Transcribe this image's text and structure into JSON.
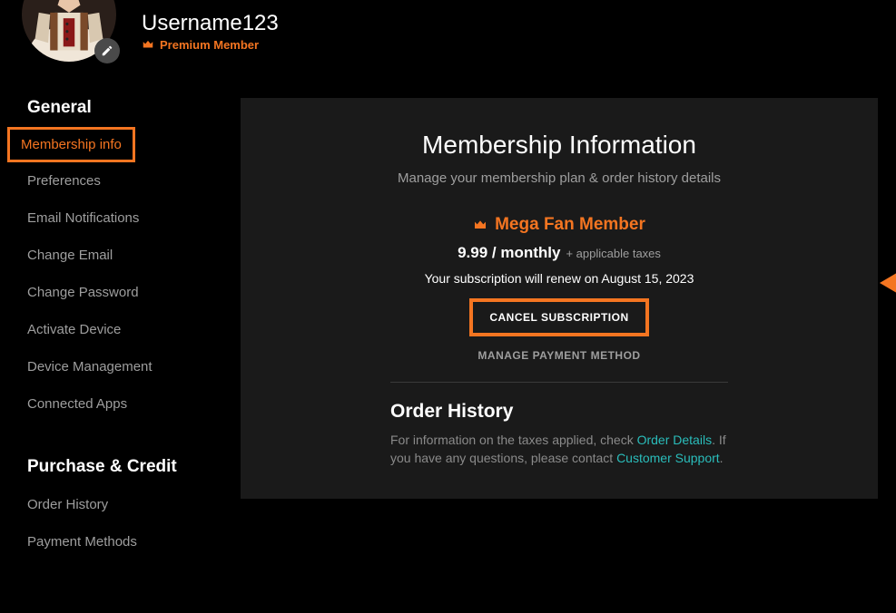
{
  "user": {
    "name": "Username123",
    "badge": "Premium Member"
  },
  "sidebar": {
    "groups": [
      {
        "heading": "General",
        "items": [
          {
            "label": "Membership info",
            "active": true
          },
          {
            "label": "Preferences"
          },
          {
            "label": "Email Notifications"
          },
          {
            "label": "Change Email"
          },
          {
            "label": "Change Password"
          },
          {
            "label": "Activate Device"
          },
          {
            "label": "Device Management"
          },
          {
            "label": "Connected Apps"
          }
        ]
      },
      {
        "heading": "Purchase & Credit",
        "items": [
          {
            "label": "Order History"
          },
          {
            "label": "Payment Methods"
          }
        ]
      }
    ]
  },
  "main": {
    "title": "Membership Information",
    "subtitle": "Manage your membership plan & order history details",
    "plan_name": "Mega Fan Member",
    "price": "9.99 / monthly",
    "tax_note": "+ applicable taxes",
    "renew_note": "Your subscription will renew on August 15, 2023",
    "cancel_label": "CANCEL SUBSCRIPTION",
    "manage_label": "MANAGE PAYMENT METHOD",
    "order_history": {
      "heading": "Order History",
      "text_pre": "For information on the taxes applied, check ",
      "link1": "Order Details",
      "text_mid": ". If you have any questions, please contact ",
      "link2": "Customer Support",
      "text_post": "."
    }
  }
}
